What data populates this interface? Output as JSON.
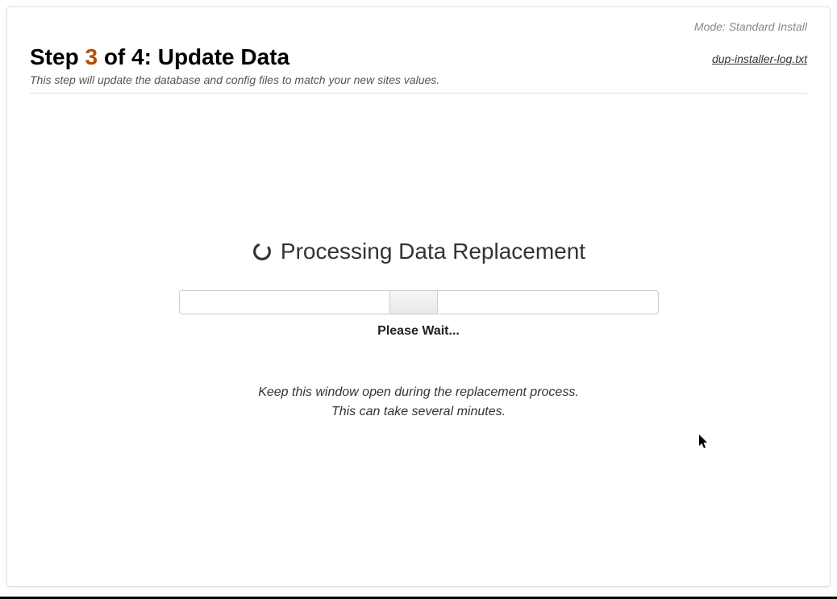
{
  "mode_label": "Mode: Standard Install",
  "step": {
    "prefix": "Step ",
    "number": "3",
    "middle": " of 4: ",
    "title": "Update Data"
  },
  "subtitle": "This step will update the database and config files to match your new sites values.",
  "log_link": "dup-installer-log.txt",
  "processing": {
    "title": "Processing Data Replacement",
    "wait": "Please Wait...",
    "info_line1": "Keep this window open during the replacement process.",
    "info_line2": "This can take several minutes."
  }
}
